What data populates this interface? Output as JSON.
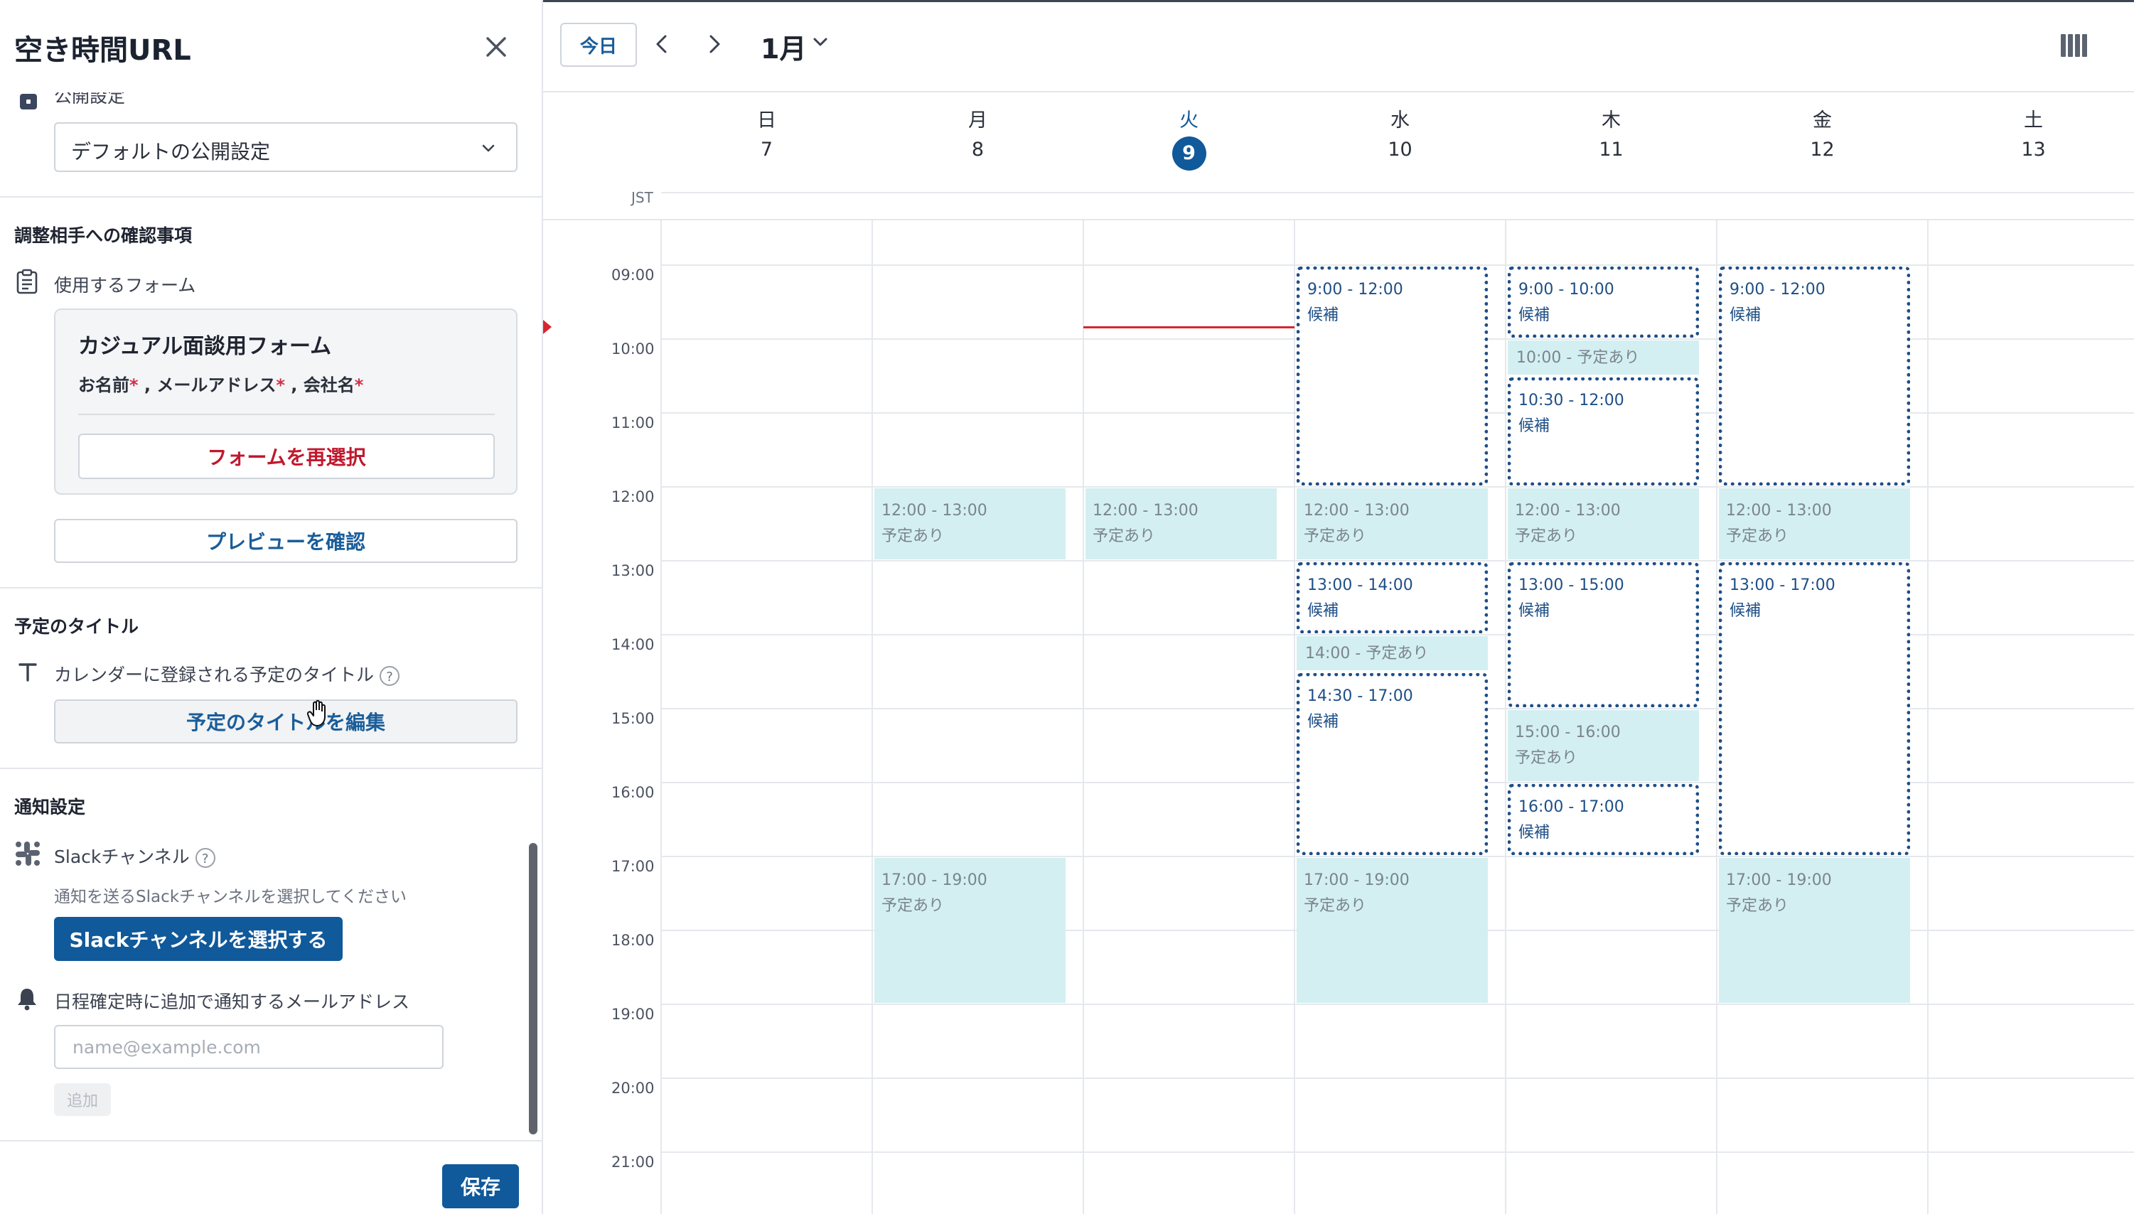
{
  "sidebar": {
    "title": "空き時間URL",
    "publish_label": "公開設定",
    "publish_select_value": "デフォルトの公開設定",
    "confirm_section_title": "調整相手への確認事項",
    "form_label": "使用するフォーム",
    "form_card": {
      "name": "カジュアル面談用フォーム",
      "fields": [
        {
          "label": "お名前",
          "required": true
        },
        {
          "label": "メールアドレス",
          "required": true
        },
        {
          "label": "会社名",
          "required": true
        }
      ],
      "separator": " , ",
      "required_mark": "*",
      "reselect_label": "フォームを再選択"
    },
    "preview_label": "プレビューを確認",
    "title_section_title": "予定のタイトル",
    "title_label": "カレンダーに登録される予定のタイトル",
    "title_edit_label": "予定のタイトルを編集",
    "notify_section_title": "通知設定",
    "slack_label": "Slackチャンネル",
    "slack_hint": "通知を送るSlackチャンネルを選択してください",
    "slack_button": "Slackチャンネルを選択する",
    "email_label": "日程確定時に追加で通知するメールアドレス",
    "email_placeholder": "name@example.com",
    "add_label": "追加",
    "save_label": "保存",
    "help_mark": "?"
  },
  "toolbar": {
    "today_label": "今日",
    "month_label": "1月"
  },
  "calendar": {
    "timezone": "JST",
    "today_index": 2,
    "now_time": "09:50",
    "days": [
      {
        "weekday": "日",
        "date": "7"
      },
      {
        "weekday": "月",
        "date": "8"
      },
      {
        "weekday": "火",
        "date": "9"
      },
      {
        "weekday": "水",
        "date": "10"
      },
      {
        "weekday": "木",
        "date": "11"
      },
      {
        "weekday": "金",
        "date": "12"
      },
      {
        "weekday": "土",
        "date": "13"
      }
    ],
    "hours": [
      "09:00",
      "10:00",
      "11:00",
      "12:00",
      "13:00",
      "14:00",
      "15:00",
      "16:00",
      "17:00",
      "18:00",
      "19:00",
      "20:00",
      "21:00"
    ],
    "busy_label": "予定あり",
    "candidate_label": "候補",
    "events": [
      {
        "day": 1,
        "start": "12:00",
        "end": "13:00",
        "kind": "busy",
        "time": "12:00 - 13:00"
      },
      {
        "day": 1,
        "start": "17:00",
        "end": "19:00",
        "kind": "busy",
        "time": "17:00 - 19:00"
      },
      {
        "day": 2,
        "start": "12:00",
        "end": "13:00",
        "kind": "busy",
        "time": "12:00 - 13:00"
      },
      {
        "day": 3,
        "start": "09:00",
        "end": "12:00",
        "kind": "candidate",
        "time": "9:00 - 12:00"
      },
      {
        "day": 3,
        "start": "12:00",
        "end": "13:00",
        "kind": "busy",
        "time": "12:00 - 13:00"
      },
      {
        "day": 3,
        "start": "13:00",
        "end": "14:00",
        "kind": "candidate",
        "time": "13:00 - 14:00"
      },
      {
        "day": 3,
        "start": "14:00",
        "end": "14:30",
        "kind": "busy",
        "time": "14:00 - 予定あり",
        "single": true
      },
      {
        "day": 3,
        "start": "14:30",
        "end": "17:00",
        "kind": "candidate",
        "time": "14:30 - 17:00"
      },
      {
        "day": 3,
        "start": "17:00",
        "end": "19:00",
        "kind": "busy",
        "time": "17:00 - 19:00"
      },
      {
        "day": 4,
        "start": "09:00",
        "end": "10:00",
        "kind": "candidate",
        "time": "9:00 - 10:00"
      },
      {
        "day": 4,
        "start": "10:00",
        "end": "10:30",
        "kind": "busy",
        "time": "10:00 - 予定あり",
        "single": true
      },
      {
        "day": 4,
        "start": "10:30",
        "end": "12:00",
        "kind": "candidate",
        "time": "10:30 - 12:00"
      },
      {
        "day": 4,
        "start": "12:00",
        "end": "13:00",
        "kind": "busy",
        "time": "12:00 - 13:00"
      },
      {
        "day": 4,
        "start": "13:00",
        "end": "15:00",
        "kind": "candidate",
        "time": "13:00 - 15:00"
      },
      {
        "day": 4,
        "start": "15:00",
        "end": "16:00",
        "kind": "busy",
        "time": "15:00 - 16:00"
      },
      {
        "day": 4,
        "start": "16:00",
        "end": "17:00",
        "kind": "candidate",
        "time": "16:00 - 17:00"
      },
      {
        "day": 5,
        "start": "09:00",
        "end": "12:00",
        "kind": "candidate",
        "time": "9:00 - 12:00"
      },
      {
        "day": 5,
        "start": "12:00",
        "end": "13:00",
        "kind": "busy",
        "time": "12:00 - 13:00"
      },
      {
        "day": 5,
        "start": "13:00",
        "end": "17:00",
        "kind": "candidate",
        "time": "13:00 - 17:00"
      },
      {
        "day": 5,
        "start": "17:00",
        "end": "19:00",
        "kind": "busy",
        "time": "17:00 - 19:00"
      }
    ]
  },
  "colors": {
    "accent": "#10599a",
    "busy_bg": "#d3eff2",
    "candidate_border": "#1e4f86",
    "now_line": "#d8262f",
    "danger_text": "#c0182e"
  },
  "icons": {
    "close": "close-icon",
    "publish": "lock-icon",
    "form": "clipboard-icon",
    "title": "text-t-icon",
    "slack": "slack-icon",
    "bell": "bell-icon",
    "prev": "chevron-left-icon",
    "next": "chevron-right-icon",
    "month": "chevron-down-icon",
    "view": "columns-view-icon"
  }
}
